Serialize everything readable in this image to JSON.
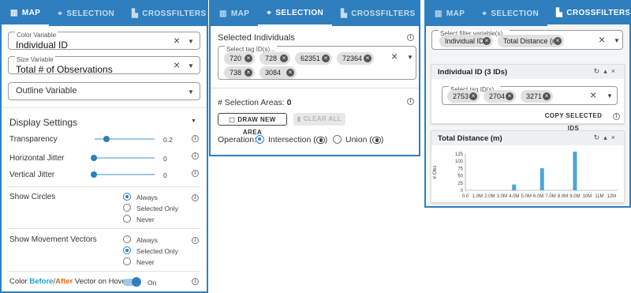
{
  "panel_map": {
    "tabs": [
      {
        "label": "MAP",
        "icon": "map-icon",
        "active": true
      },
      {
        "label": "SELECTION",
        "icon": "crosshair-icon",
        "active": false
      },
      {
        "label": "CROSSFILTERS",
        "icon": "bar-chart-icon",
        "active": false
      }
    ],
    "color_variable": {
      "label": "Color Variable",
      "value": "Individual ID"
    },
    "size_variable": {
      "label": "Size Variable",
      "value": "Total # of Observations"
    },
    "outline_variable": {
      "placeholder": "Outline Variable"
    },
    "display_settings": "Display Settings",
    "transparency": {
      "label": "Transparency",
      "value": "0.2",
      "fraction": 0.2
    },
    "horizontal_jitter": {
      "label": "Horizontal Jitter",
      "value": "0",
      "fraction": 0
    },
    "vertical_jitter": {
      "label": "Vertical Jitter",
      "value": "0",
      "fraction": 0
    },
    "show_circles": {
      "label": "Show Circles",
      "options": [
        "Always",
        "Selected Only",
        "Never"
      ],
      "selected": "Always"
    },
    "show_vectors": {
      "label": "Show Movement Vectors",
      "options": [
        "Always",
        "Selected Only",
        "Never"
      ],
      "selected": "Selected Only"
    },
    "color_vector": {
      "prefix": "Color ",
      "before": "Before",
      "slash": "/",
      "after": "After",
      "suffix": " Vector on Hover",
      "state": "On",
      "before_color": "#1ba0d8",
      "after_color": "#e06a1b"
    }
  },
  "panel_selection": {
    "tabs": [
      {
        "label": "MAP",
        "icon": "map-icon",
        "active": false
      },
      {
        "label": "SELECTION",
        "icon": "crosshair-icon",
        "active": true
      },
      {
        "label": "CROSSFILTERS",
        "icon": "bar-chart-icon",
        "active": false
      }
    ],
    "selected_individuals": "Selected Individuals",
    "tag_field_label": "Select tag ID(s)...",
    "tags": [
      "720",
      "728",
      "62351",
      "72364",
      "738",
      "3084"
    ],
    "selection_areas_label": "# Selection Areas:",
    "selection_areas_count": "0",
    "draw_button": "DRAW NEW AREA",
    "clear_button": "CLEAR ALL",
    "operation_label": "Operation:",
    "operation_options": [
      "Intersection",
      "Union"
    ],
    "operation_selected": "Intersection"
  },
  "panel_crossfilters": {
    "tabs": [
      {
        "label": "MAP",
        "icon": "map-icon",
        "active": false
      },
      {
        "label": "SELECTION",
        "icon": "crosshair-icon",
        "active": false
      },
      {
        "label": "CROSSFILTERS",
        "icon": "bar-chart-icon",
        "active": true
      }
    ],
    "filter_field_label": "Select filter variable(s)...",
    "filters": [
      "Individual ID",
      "Total Distance (m)"
    ],
    "card_id": {
      "title": "Individual ID (3 IDs)",
      "field_label": "Select tag ID(s)...",
      "tags": [
        "2753",
        "2704",
        "3271"
      ],
      "copy_button": "COPY SELECTED IDS"
    },
    "card_distance": {
      "title": "Total Distance (m)"
    }
  },
  "chart_data": {
    "type": "bar",
    "title": "Total Distance (m)",
    "xlabel": "",
    "ylabel": "# Obs",
    "x_tick_labels": [
      "0.0",
      "1.0M",
      "2.0M",
      "3.0M",
      "4.0M",
      "5.0M",
      "6.0M",
      "7.0M",
      "8.0M",
      "9.0M",
      "10M",
      "11M",
      "12M"
    ],
    "y_tick_labels": [
      "0",
      "25",
      "50",
      "75",
      "100",
      "125"
    ],
    "xlim": [
      0,
      12500000
    ],
    "ylim": [
      0,
      125
    ],
    "bar_color": "#4ba6d8",
    "bars": [
      {
        "x": 4000000,
        "value": 20
      },
      {
        "x": 6300000,
        "value": 76
      },
      {
        "x": 9000000,
        "value": 133
      }
    ]
  },
  "colors": {
    "accent": "#2f7fbf",
    "accent_light": "#9fc8ea"
  }
}
